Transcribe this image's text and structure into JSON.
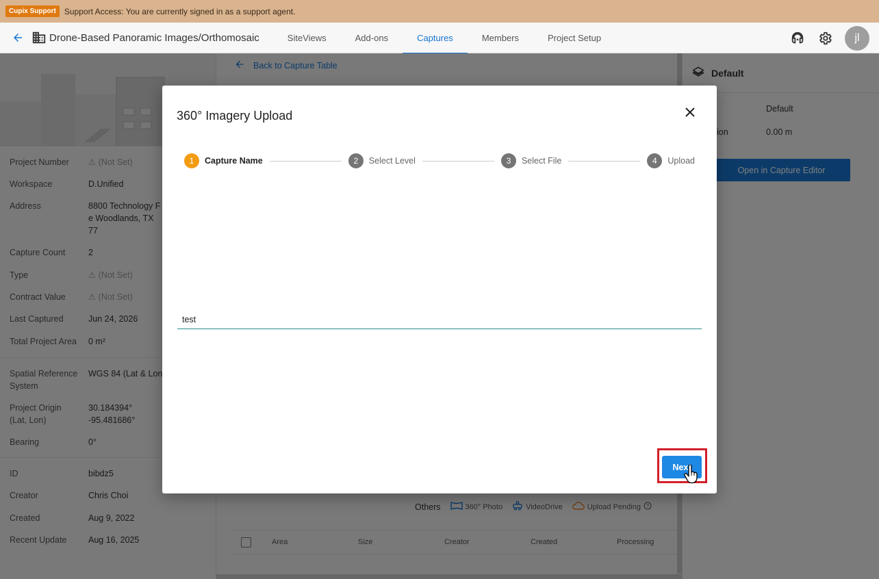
{
  "banner": {
    "badge": "Cupix Support",
    "text": "Support Access: You are currently signed in as a support agent."
  },
  "topbar": {
    "project_title": "Drone-Based Panoramic Images/Orthomosaic",
    "tabs": [
      {
        "label": "SiteViews",
        "active": false
      },
      {
        "label": "Add-ons",
        "active": false
      },
      {
        "label": "Captures",
        "active": true
      },
      {
        "label": "Members",
        "active": false
      },
      {
        "label": "Project Setup",
        "active": false
      }
    ],
    "avatar_initials": "jl"
  },
  "project_info": {
    "rows": [
      {
        "label": "Project Number",
        "value": "⚠ (Not Set)"
      },
      {
        "label": "Workspace",
        "value": "D.Unified"
      },
      {
        "label": "Address",
        "value": "8800 Technology F e Woodlands, TX 77"
      },
      {
        "label": "Capture Count",
        "value": "2"
      },
      {
        "label": "Type",
        "value": "⚠ (Not Set)"
      },
      {
        "label": "Contract Value",
        "value": "⚠ (Not Set)"
      },
      {
        "label": "Last Captured",
        "value": "Jun 24, 2026"
      },
      {
        "label": "Total Project Area",
        "value": "0 m²"
      }
    ],
    "spatial_rows": [
      {
        "label": "Spatial Reference System",
        "value": "WGS 84 (Lat & Lon"
      },
      {
        "label": "Project Origin (Lat, Lon)",
        "value": "30.184394° -95.481686°"
      },
      {
        "label": "Bearing",
        "value": "0°"
      }
    ],
    "meta_rows": [
      {
        "label": "ID",
        "value": "bibdz5"
      },
      {
        "label": "Creator",
        "value": "Chris Choi"
      },
      {
        "label": "Created",
        "value": "Aug 9, 2022"
      },
      {
        "label": "Recent Update",
        "value": "Aug 16, 2025"
      }
    ]
  },
  "middle": {
    "back_link": "Back to Capture Table",
    "legend": {
      "others": "Others",
      "photo": "360° Photo",
      "videodrive": "VideoDrive",
      "pending": "Upload Pending"
    },
    "table_columns": [
      "Area",
      "Size",
      "Creator",
      "Created",
      "Processing"
    ]
  },
  "right_panel": {
    "title": "Default",
    "level_value": "Default",
    "elevation_label": "ion",
    "elevation_value": "0.00 m",
    "editor_button": "Open in Capture Editor"
  },
  "modal": {
    "title": "360° Imagery Upload",
    "steps": [
      {
        "num": "1",
        "label": "Capture Name",
        "active": true
      },
      {
        "num": "2",
        "label": "Select Level",
        "active": false
      },
      {
        "num": "3",
        "label": "Select File",
        "active": false
      },
      {
        "num": "4",
        "label": "Upload",
        "active": false
      }
    ],
    "capture_name_value": "test",
    "next_label": "Next"
  },
  "colors": {
    "accent": "#1976d2",
    "step_active": "#f39c12",
    "highlight": "#d21f2b",
    "banner": "#d9b48f"
  }
}
